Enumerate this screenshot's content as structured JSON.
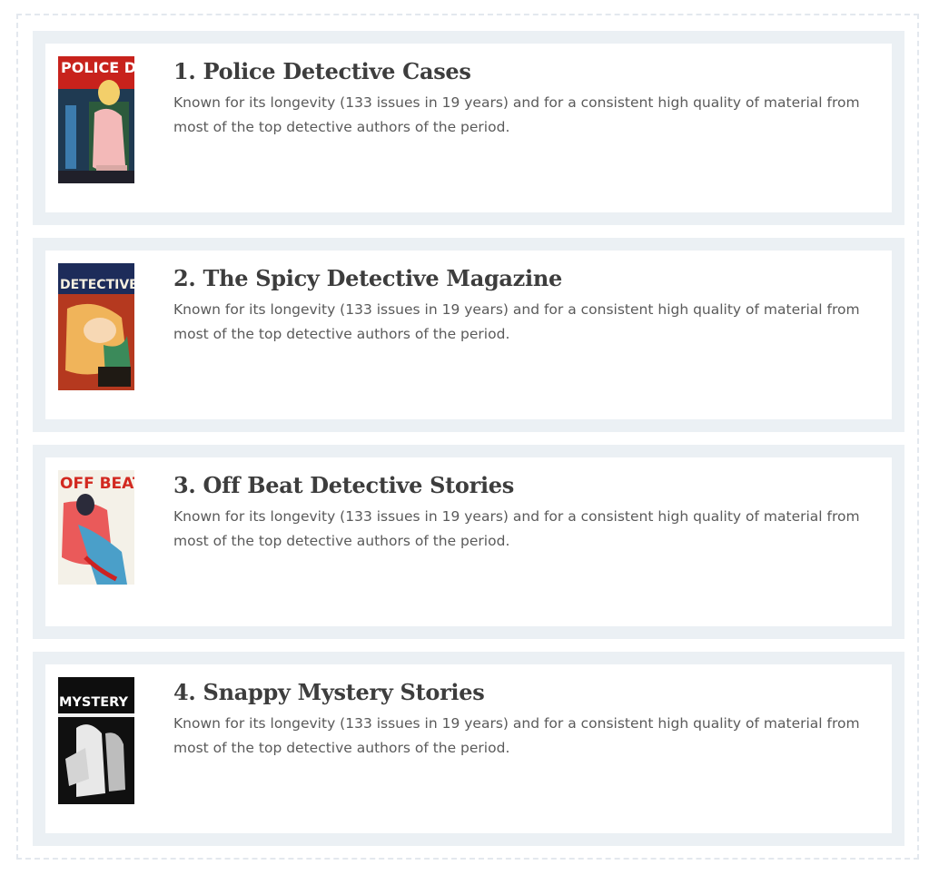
{
  "items": [
    {
      "number": "1.",
      "title": "Police Detective Cases",
      "description": "Known for its longevity (133 issues in 19 years) and for a consistent high quality of material from most of the top detective authors of the period.",
      "cover_icon": "police-detective-cover",
      "cover_text": "POLICE Detective"
    },
    {
      "number": "2.",
      "title": "The Spicy Detective Magazine",
      "description": "Known for its longevity (133 issues in 19 years) and for a consistent high quality of material from most of the top detective authors of the period.",
      "cover_icon": "spicy-detective-cover",
      "cover_text": "DETECTIVE"
    },
    {
      "number": "3.",
      "title": "Off Beat Detective Stories",
      "description": "Known for its longevity (133 issues in 19 years) and for a consistent high quality of material from most of the top detective authors of the period.",
      "cover_icon": "off-beat-cover",
      "cover_text": "OFF BEAT"
    },
    {
      "number": "4.",
      "title": "Snappy Mystery Stories",
      "description": "Known for its longevity (133 issues in 19 years) and for a consistent high quality of material from most of the top detective authors of the period.",
      "cover_icon": "snappy-mystery-cover",
      "cover_text": "MYSTERY"
    }
  ],
  "colors": {
    "card_bg": "#ebf0f4",
    "title": "#3d3d3d",
    "text": "#5a5a5a",
    "dash": "#e3e8ee"
  }
}
